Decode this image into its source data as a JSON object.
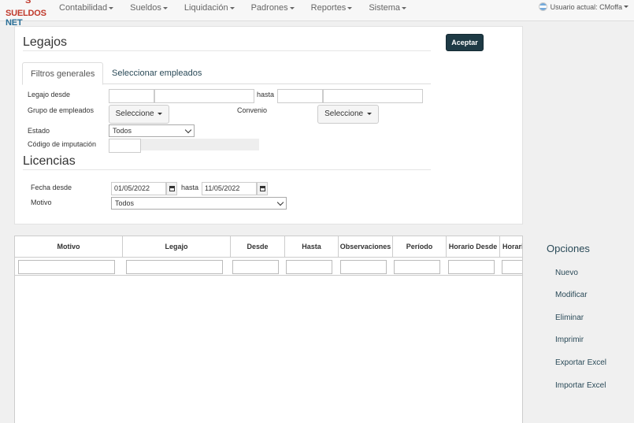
{
  "nav": {
    "logo_part1": "SUELDOS",
    "logo_part2": "NET",
    "logo_mark": "S",
    "menu": [
      "Contabilidad",
      "Sueldos",
      "Liquidación",
      "Padrones",
      "Reportes",
      "Sistema"
    ],
    "user_label": "Usuario actual: CMoffa"
  },
  "legajos": {
    "title": "Legajos",
    "accept_label": "Aceptar",
    "tabs": [
      "Filtros generales",
      "Seleccionar empleados"
    ],
    "legajo_desde_label": "Legajo desde",
    "hasta_label": "hasta",
    "grupo_label": "Grupo de empleados",
    "convenio_label": "Convenio",
    "seleccione_label": "Seleccione",
    "estado_label": "Estado",
    "estado_value": "Todos",
    "codigo_label": "Código de imputación"
  },
  "licencias": {
    "title": "Licencias",
    "fecha_desde_label": "Fecha desde",
    "hasta_label": "hasta",
    "fecha_desde_value": "01/05/2022",
    "fecha_hasta_value": "11/05/2022",
    "motivo_label": "Motivo",
    "motivo_value": "Todos"
  },
  "grid": {
    "columns": [
      "Motivo",
      "Legajo",
      "Desde",
      "Hasta",
      "Observaciones",
      "Período",
      "Horario Desde",
      "Horario Hasta"
    ]
  },
  "options": {
    "title": "Opciones",
    "items": [
      "Nuevo",
      "Modificar",
      "Eliminar",
      "Imprimir",
      "Exportar Excel",
      "Importar Excel"
    ]
  },
  "colors": {
    "accent_dark": "#1e3a45",
    "link": "#2a4a58",
    "logo_red": "#c0392b",
    "logo_blue": "#2a6f97"
  }
}
